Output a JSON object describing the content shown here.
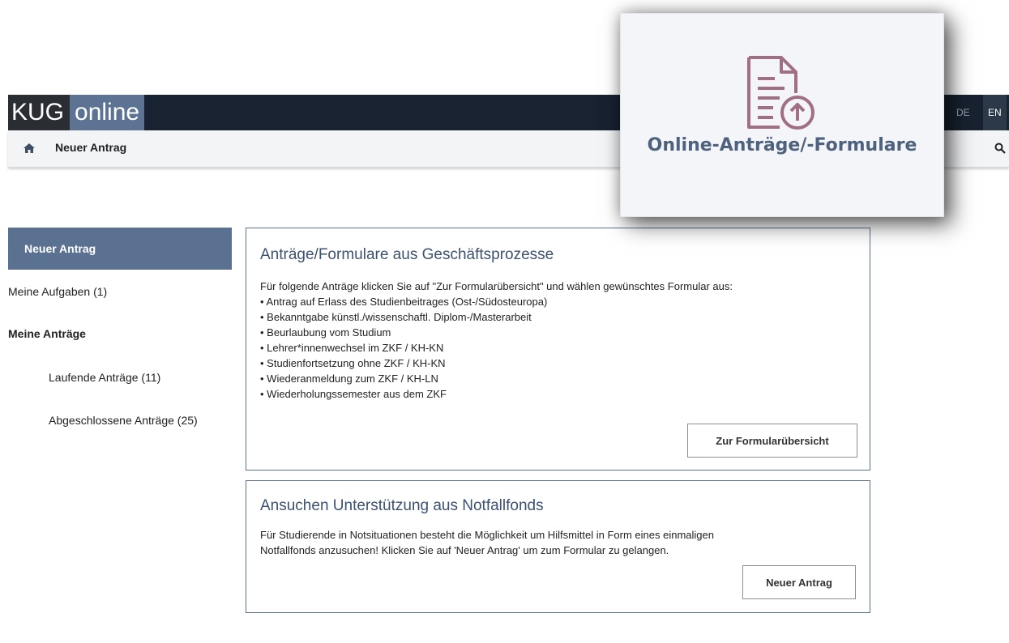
{
  "header": {
    "logo_kug": "KUG",
    "logo_online": "online",
    "lang_de": "DE",
    "lang_en": "EN"
  },
  "breadcrumb": {
    "current": "Neuer Antrag"
  },
  "sidebar": {
    "items": [
      {
        "label": "Neuer Antrag",
        "active": true
      },
      {
        "label": "Meine Aufgaben (1)"
      },
      {
        "label": "Meine Anträge"
      },
      {
        "label": "Laufende Anträge (11)"
      },
      {
        "label": "Abgeschlossene Anträge (25)"
      }
    ]
  },
  "panels": [
    {
      "title": "Anträge/Formulare aus Geschäftsprozesse",
      "intro": "Für folgende Anträge klicken Sie auf \"Zur Formularübersicht\" und wählen gewünschtes Formular aus:",
      "items": [
        "Antrag auf Erlass des Studienbeitrages (Ost-/Südosteuropa)",
        "Bekanntgabe künstl./wissenschaftl. Diplom-/Masterarbeit",
        "Beurlaubung vom Studium",
        "Lehrer*innenwechsel im ZKF / KH-KN",
        "Studienfortsetzung ohne ZKF / KH-KN",
        "Wiederanmeldung zum ZKF / KH-LN",
        "Wiederholungssemester aus dem ZKF"
      ],
      "button": "Zur Formularübersicht"
    },
    {
      "title": "Ansuchen Unterstützung aus Notfallfonds",
      "intro_line1": "Für Studierende in Notsituationen besteht die Möglichkeit um Hilfsmittel in Form eines einmaligen",
      "intro_line2": "Notfallfonds anzusuchen! Klicken Sie auf 'Neuer Antrag' um zum Formular zu gelangen.",
      "button": "Neuer Antrag"
    }
  ],
  "tile": {
    "label": "Online-Anträge/-Formulare",
    "icon": "document-upload-icon",
    "accent": "#a06f86"
  },
  "colors": {
    "topbar": "#182230",
    "accent": "#5a7191",
    "title": "#3d5170"
  }
}
